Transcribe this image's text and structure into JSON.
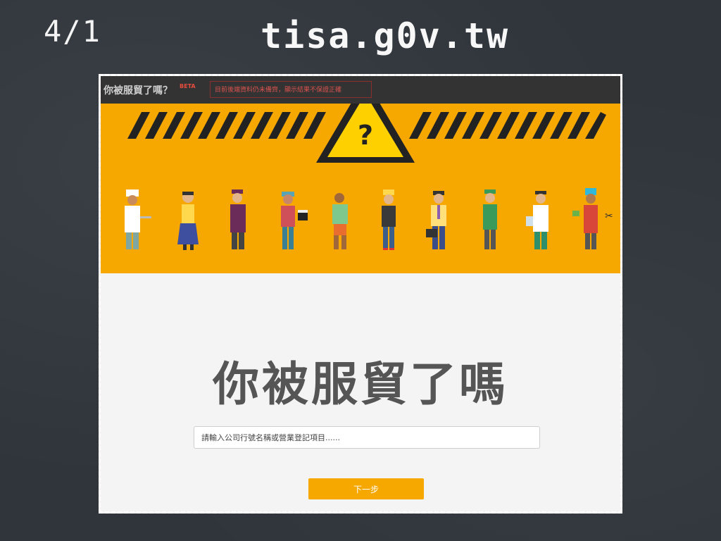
{
  "slide": {
    "number": "4/1",
    "title": "tisa.g0v.tw"
  },
  "site": {
    "brand": "你被服貿了嗎？",
    "beta": "BETA",
    "notice": "目前後端資料仍未備齊，顯示結果不保證正確",
    "hero_symbol": "?",
    "main_title": "你被服貿了嗎",
    "search_placeholder": "請輸入公司行號名稱或營業登記項目......",
    "next_label": "下一步"
  },
  "colors": {
    "accent": "#f6a800",
    "topbar": "#333333",
    "background": "#2f353b"
  },
  "icons": [
    "warning-triangle-icon",
    "chef-icon",
    "teacher-icon",
    "bellhop-icon",
    "film-director-icon",
    "worker-icon",
    "construction-worker-icon",
    "businessman-icon",
    "shop-clerk-icon",
    "doctor-icon",
    "hairdresser-icon"
  ]
}
